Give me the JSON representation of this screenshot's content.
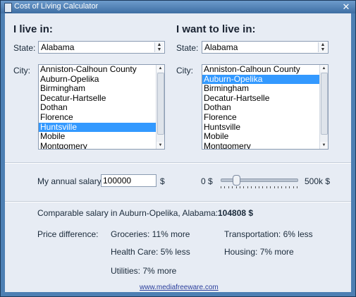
{
  "window": {
    "title": "Cost of Living Calculator",
    "close": "✕"
  },
  "left": {
    "heading": "I live in:",
    "state_label": "State:",
    "state_value": "Alabama",
    "city_label": "City:",
    "cities": [
      "Anniston-Calhoun County",
      "Auburn-Opelika",
      "Birmingham",
      "Decatur-Hartselle",
      "Dothan",
      "Florence",
      "Huntsville",
      "Mobile",
      "Montgomery"
    ],
    "selected_city": "Huntsville"
  },
  "right": {
    "heading": "I want to live in:",
    "state_label": "State:",
    "state_value": "Alabama",
    "city_label": "City:",
    "cities": [
      "Anniston-Calhoun County",
      "Auburn-Opelika",
      "Birmingham",
      "Decatur-Hartselle",
      "Dothan",
      "Florence",
      "Huntsville",
      "Mobile",
      "Montgomery"
    ],
    "selected_city": "Auburn-Opelika"
  },
  "salary": {
    "label": "My annual salary:",
    "value": "100000",
    "unit": "$",
    "slider_min": "0 $",
    "slider_max": "500k $",
    "slider_fraction": 0.2
  },
  "result": {
    "comparable_label": "Comparable salary in Auburn-Opelika, Alabama:",
    "comparable_value": "104808 $",
    "price_diff_label": "Price difference:",
    "groceries": "Groceries: 11% more",
    "transportation": "Transportation: 6% less",
    "health": "Health Care: 5% less",
    "housing": "Housing: 7% more",
    "utilities": "Utilities: 7% more"
  },
  "footer": {
    "link": "www.mediafreeware.com"
  }
}
